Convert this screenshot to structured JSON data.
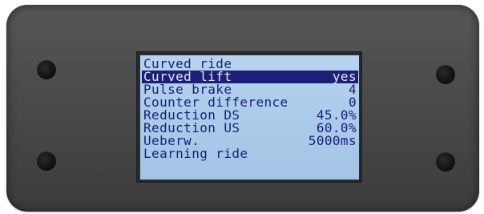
{
  "display": {
    "rows": [
      {
        "label": "Curved ride",
        "value": ""
      },
      {
        "label": "Curved lift",
        "value": "yes",
        "selected": true
      },
      {
        "label": "Pulse brake",
        "value": "4"
      },
      {
        "label": "Counter difference",
        "value": "0"
      },
      {
        "label": "Reduction DS",
        "value": "45.0%"
      },
      {
        "label": "Reduction US",
        "value": "60.0%"
      },
      {
        "label": "Ueberw.",
        "value": "5000ms"
      },
      {
        "label": "Learning ride",
        "value": ""
      }
    ]
  },
  "colors": {
    "screen_bg": "#aacbea",
    "text": "#1b1f7a",
    "highlight_bg": "#1c1f78",
    "highlight_text": "#dfe9f7",
    "panel": "#4a4a4a"
  }
}
